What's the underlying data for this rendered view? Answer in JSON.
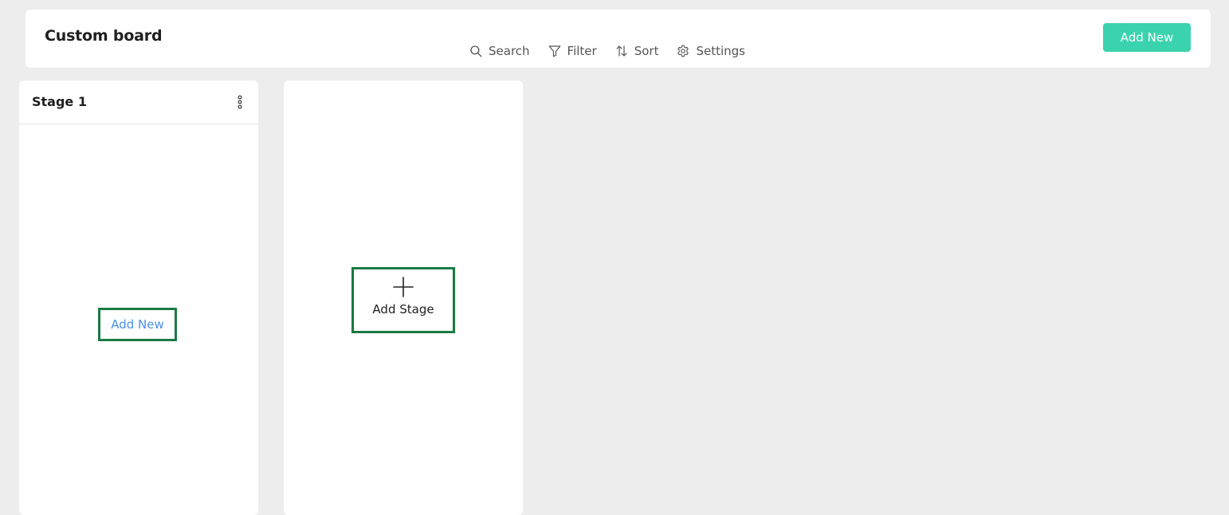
{
  "header": {
    "title": "Custom board",
    "toolbar": {
      "search": {
        "label": "Search",
        "icon": "search-icon"
      },
      "filter": {
        "label": "Filter",
        "icon": "filter-icon"
      },
      "sort": {
        "label": "Sort",
        "icon": "sort-icon"
      },
      "settings": {
        "label": "Settings",
        "icon": "gear-icon"
      }
    },
    "add_new_label": "Add New"
  },
  "stages": [
    {
      "title": "Stage 1",
      "menu_icon": "more-vertical-icon",
      "add_new_label": "Add New"
    }
  ],
  "add_stage": {
    "label": "Add Stage",
    "icon": "plus-icon"
  },
  "colors": {
    "accent": "#3ad3ae",
    "link": "#4a90e2",
    "highlight_border": "#1a7a43",
    "background": "#ededed"
  }
}
